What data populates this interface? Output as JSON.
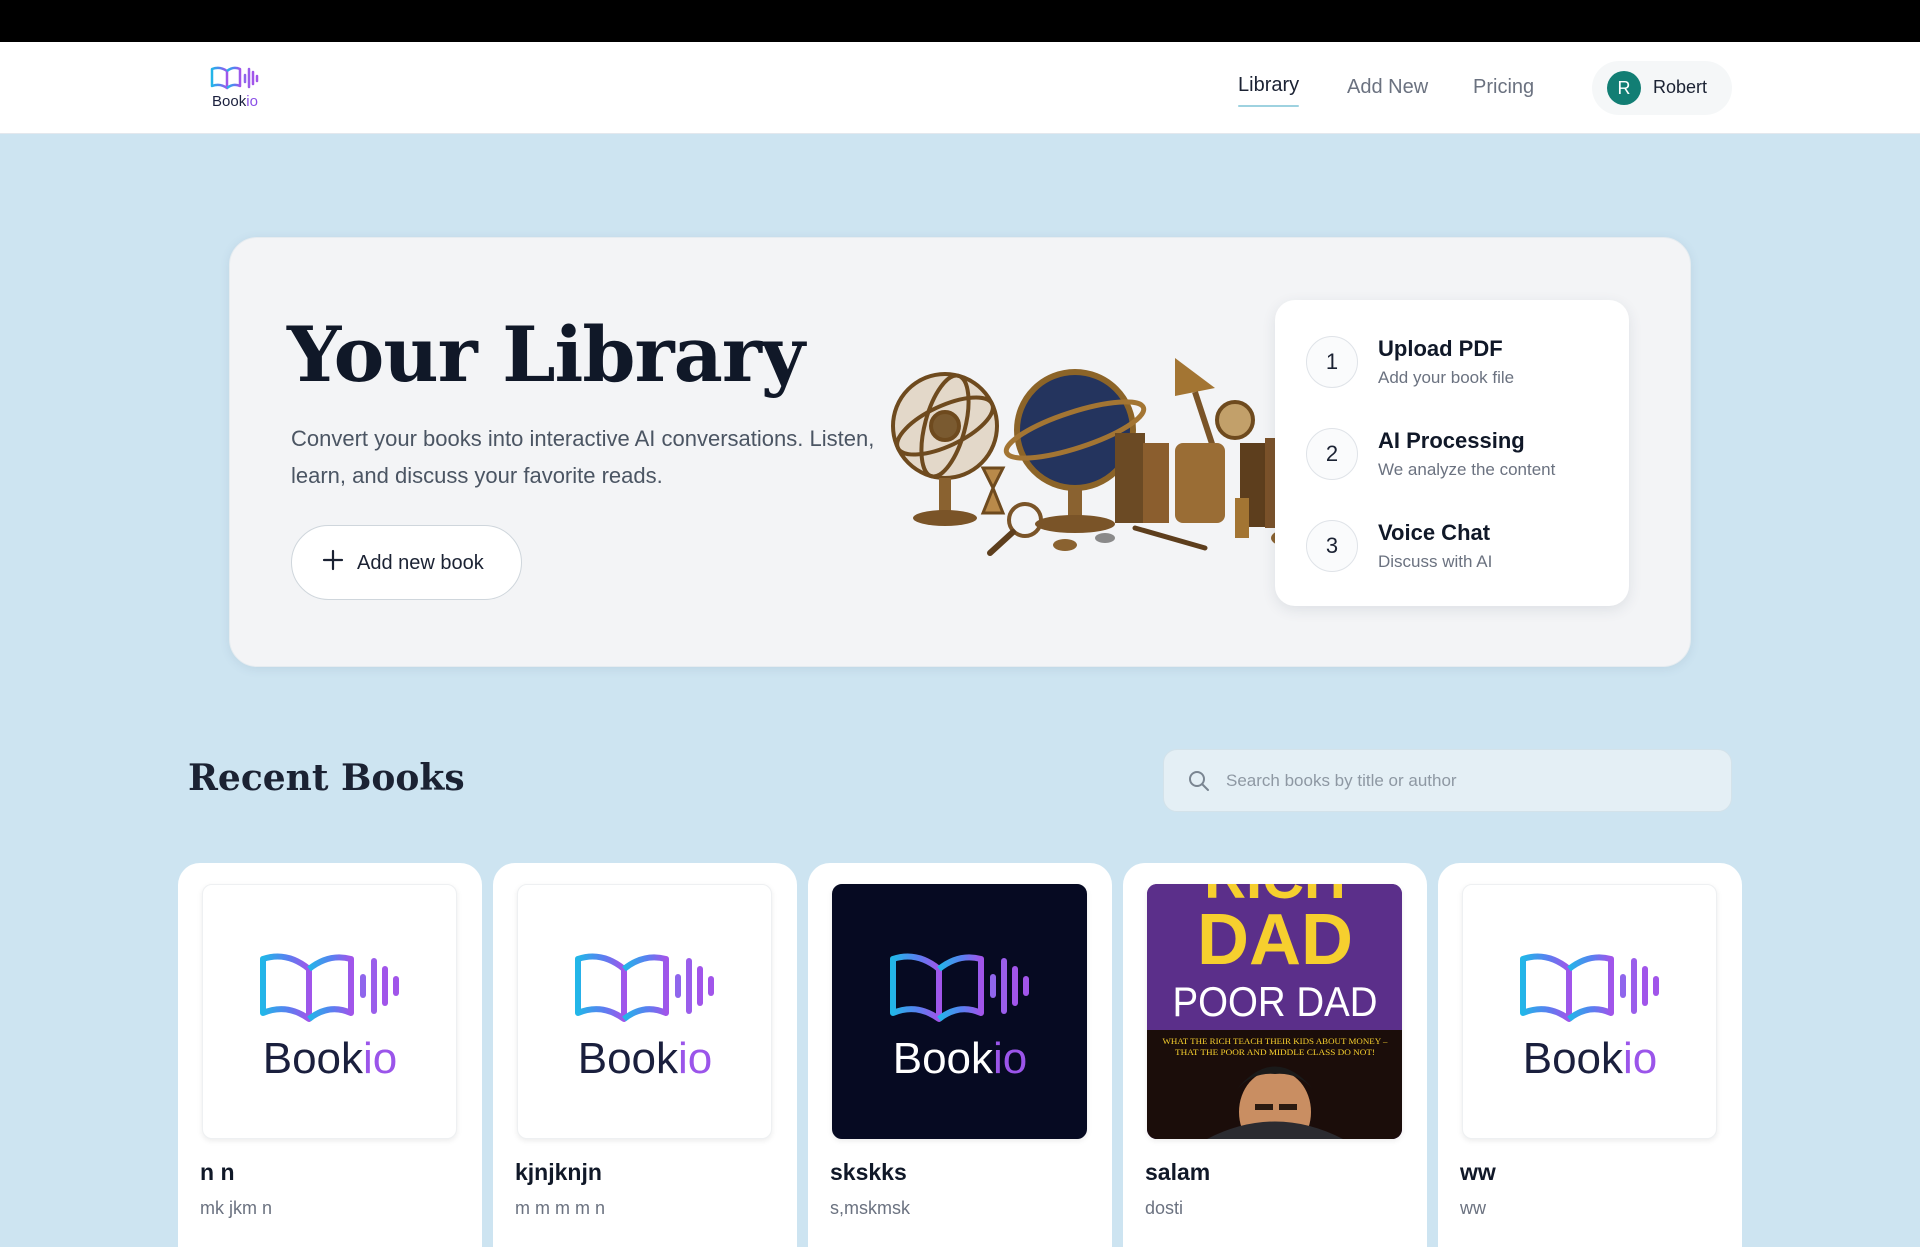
{
  "app": {
    "logo_text": "Book",
    "logo_text_accent": "io"
  },
  "nav": {
    "links": [
      {
        "label": "Library",
        "active": true
      },
      {
        "label": "Add New",
        "active": false
      },
      {
        "label": "Pricing",
        "active": false
      }
    ],
    "user": {
      "initial": "R",
      "name": "Robert",
      "avatar_color": "#127e74"
    }
  },
  "hero": {
    "title": "Your Library",
    "description": "Convert your books into interactive AI conversations. Listen, learn, and discuss your favorite reads.",
    "add_button_label": "Add new book",
    "illustration": "vintage-brass-globes-books-illustration"
  },
  "steps": [
    {
      "number": "1",
      "title": "Upload PDF",
      "subtitle": "Add your book file"
    },
    {
      "number": "2",
      "title": "AI Processing",
      "subtitle": "We analyze the content"
    },
    {
      "number": "3",
      "title": "Voice Chat",
      "subtitle": "Discuss with AI"
    }
  ],
  "recent": {
    "title": "Recent Books",
    "search_placeholder": "Search books by title or author",
    "books": [
      {
        "title": "n n",
        "author": "mk jkm n",
        "cover": "bookio-logo-light"
      },
      {
        "title": "kjnjknjn",
        "author": "m m m m n",
        "cover": "bookio-logo-light"
      },
      {
        "title": "skskks",
        "author": "s,mskmsk",
        "cover": "bookio-logo-dark"
      },
      {
        "title": "salam",
        "author": "dosti",
        "cover": "rich-dad-poor-dad-cover"
      },
      {
        "title": "ww",
        "author": "ww",
        "cover": "bookio-logo-light"
      }
    ],
    "rich_dad_cover": {
      "line1": "RICH",
      "line2": "DAD",
      "line3": "POOR DAD",
      "tagline1": "WHAT THE RICH TEACH THEIR KIDS ABOUT MONEY –",
      "tagline2": "THAT THE POOR AND MIDDLE CLASS DO NOT!"
    }
  },
  "colors": {
    "page_bg": "#cde4f1",
    "accent_teal": "#9ed2e0",
    "brand_purple": "#8a4fe6",
    "brand_blue": "#22b6e8",
    "brand_navy": "#1a1f3d"
  }
}
